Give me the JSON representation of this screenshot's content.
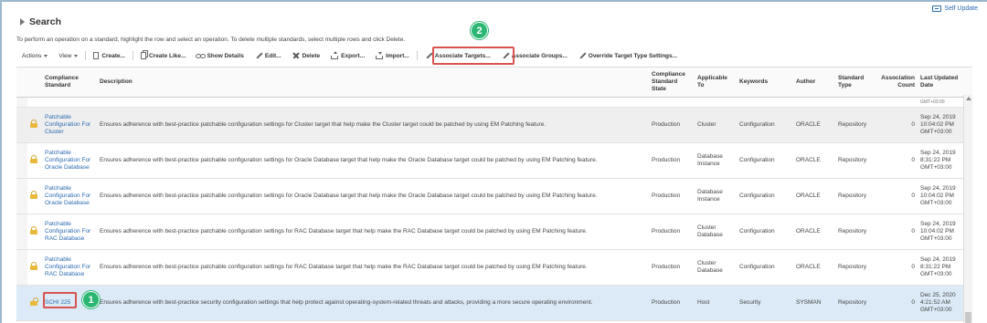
{
  "self_update": {
    "label": "Self Update",
    "icon": "self-update-icon"
  },
  "search": {
    "title": "Search"
  },
  "instructions": "To perform an operation on a standard, highlight the row and select an operation. To delete multiple standards, select multiple rows and click Delete.",
  "toolbar": {
    "actions": "Actions",
    "view": "View",
    "create": "Create...",
    "create_like": "Create Like...",
    "show_details": "Show Details",
    "edit": "Edit...",
    "delete": "Delete",
    "export": "Export...",
    "import": "Import...",
    "associate_targets": "Associate Targets...",
    "associate_groups": "Associate Groups...",
    "override_target_type": "Override Target Type Settings..."
  },
  "annotations": {
    "badge1": "1",
    "badge2": "2",
    "highlight_color": "#d9534f",
    "badge_color": "#2bb673"
  },
  "table": {
    "headers": {
      "compliance_standard": "Compliance Standard",
      "description": "Description",
      "state": "Compliance Standard State",
      "applicable_to": "Applicable To",
      "keywords": "Keywords",
      "author": "Author",
      "standard_type": "Standard Type",
      "association_count": "Association Count",
      "last_updated": "Last Updated Date"
    },
    "partial_top": "GMT+03:00",
    "rows": [
      {
        "name": "Patchable Configuration For Cluster",
        "description": "Ensures adherence with best-practice patchable configuration settings for Cluster target that help make the Cluster target could be patched by using EM Patching feature.",
        "state": "Production",
        "applicable_to": "Cluster",
        "keywords": "Configuration",
        "author": "ORACLE",
        "type": "Repository",
        "count": "0",
        "date": "Sep 24, 2019 10:04:02 PM GMT+03:00"
      },
      {
        "name": "Patchable Configuration For Oracle Database",
        "description": "Ensures adherence with best-practice patchable configuration settings for Oracle Database target that help make the Oracle Database target could be patched by using EM Patching feature.",
        "state": "Production",
        "applicable_to": "Database Instance",
        "keywords": "Configuration",
        "author": "ORACLE",
        "type": "Repository",
        "count": "0",
        "date": "Sep 24, 2019 8:31:22 PM GMT+03:00"
      },
      {
        "name": "Patchable Configuration For Oracle Database",
        "description": "Ensures adherence with best-practice patchable configuration settings for Oracle Database target that help make the Oracle Database target could be patched by using EM Patching feature.",
        "state": "Production",
        "applicable_to": "Database Instance",
        "keywords": "Configuration",
        "author": "ORACLE",
        "type": "Repository",
        "count": "0",
        "date": "Sep 24, 2019 10:04:02 PM GMT+03:00"
      },
      {
        "name": "Patchable Configuration For RAC Database",
        "description": "Ensures adherence with best-practice patchable configuration settings for RAC Database target that help make the RAC Database target could be patched by using EM Patching feature.",
        "state": "Production",
        "applicable_to": "Cluster Database",
        "keywords": "Configuration",
        "author": "ORACLE",
        "type": "Repository",
        "count": "0",
        "date": "Sep 24, 2019 10:04:02 PM GMT+03:00"
      },
      {
        "name": "Patchable Configuration For RAC Database",
        "description": "Ensures adherence with best-practice patchable configuration settings for RAC Database target that help make the RAC Database target could be patched by using EM Patching feature.",
        "state": "Production",
        "applicable_to": "Cluster Database",
        "keywords": "Configuration",
        "author": "ORACLE",
        "type": "Repository",
        "count": "0",
        "date": "Sep 24, 2019 8:31:22 PM GMT+03:00"
      },
      {
        "name": "SCHI 225",
        "description": "Ensures adherence with best-practice security configuration settings that help protect against operating-system-related threats and attacks, providing a more secure operating environment.",
        "state": "Production",
        "applicable_to": "Host",
        "keywords": "Security",
        "author": "SYSMAN",
        "type": "Repository",
        "count": "0",
        "date": "Dec 25, 2020 4:21:52 AM GMT+03:00"
      }
    ]
  }
}
